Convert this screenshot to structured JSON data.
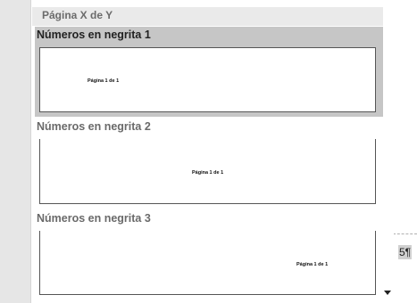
{
  "gallery": {
    "category_header": "Página X de Y",
    "options": [
      {
        "title": "Números en negrita 1",
        "preview_text": "Página 1 de 1",
        "alignment": "left",
        "selected": true
      },
      {
        "title": "Números en negrita 2",
        "preview_text": "Página 1 de 1",
        "alignment": "center",
        "selected": false
      },
      {
        "title": "Números en negrita 3",
        "preview_text": "Página 1 de 1",
        "alignment": "right",
        "selected": false
      }
    ]
  },
  "document": {
    "paragraph_marker": "5¶"
  },
  "colors": {
    "selected_background": "#c6c6c6",
    "header_background": "#eaeaea",
    "side_background": "#e6e6e6"
  },
  "icons": {
    "scroll_down": "triangle-down"
  }
}
